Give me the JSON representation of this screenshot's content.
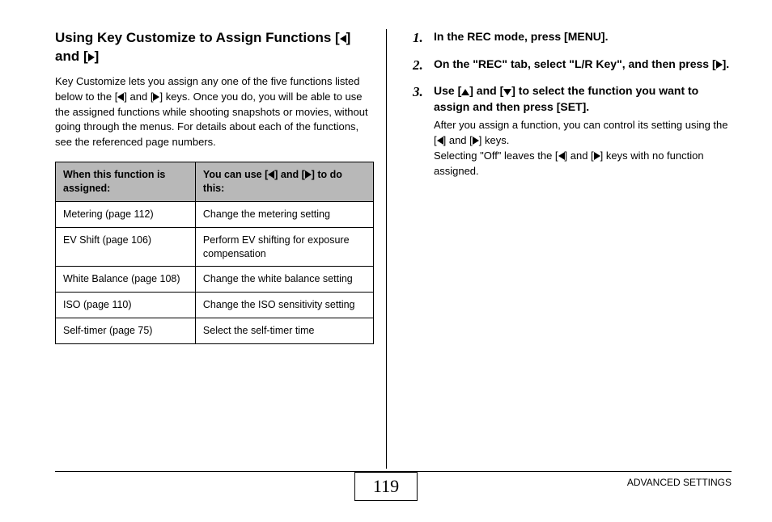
{
  "left": {
    "title_pre": "Using Key Customize to Assign Functions [",
    "title_mid": "] and [",
    "title_post": "]",
    "intro_pre": "Key Customize lets you assign any one of the five functions listed below to the [",
    "intro_mid": "] and [",
    "intro_post": "] keys. Once you do, you will be able to use the assigned functions while shooting snapshots or movies, without going through the menus. For details about each of the functions, see the referenced page numbers.",
    "th1": "When this function is assigned:",
    "th2_pre": "You can use [",
    "th2_mid": "] and [",
    "th2_post": "] to do this:",
    "rows": [
      {
        "f": "Metering (page 112)",
        "d": "Change the metering setting"
      },
      {
        "f": "EV Shift (page 106)",
        "d": "Perform EV shifting for exposure compensation"
      },
      {
        "f": "White Balance (page 108)",
        "d": "Change the white balance setting"
      },
      {
        "f": "ISO (page 110)",
        "d": "Change the ISO sensitivity setting"
      },
      {
        "f": "Self-timer (page 75)",
        "d": "Select the self-timer time"
      }
    ]
  },
  "right": {
    "s1": "In the REC mode, press [MENU].",
    "s2_pre": "On the \"REC\" tab, select \"L/R Key\", and then press [",
    "s2_post": "].",
    "s3_pre": "Use [",
    "s3_mid": "] and [",
    "s3_post": "] to select the function you want to assign and then press [SET].",
    "s3b_pre": "After you assign a function, you can control its setting using the [",
    "s3b_mid": "] and [",
    "s3b_post": "] keys.",
    "s3c_pre": "Selecting \"Off\" leaves the [",
    "s3c_mid": "] and [",
    "s3c_post": "] keys with no function assigned."
  },
  "footer": {
    "label": "ADVANCED SETTINGS",
    "page": "119"
  }
}
